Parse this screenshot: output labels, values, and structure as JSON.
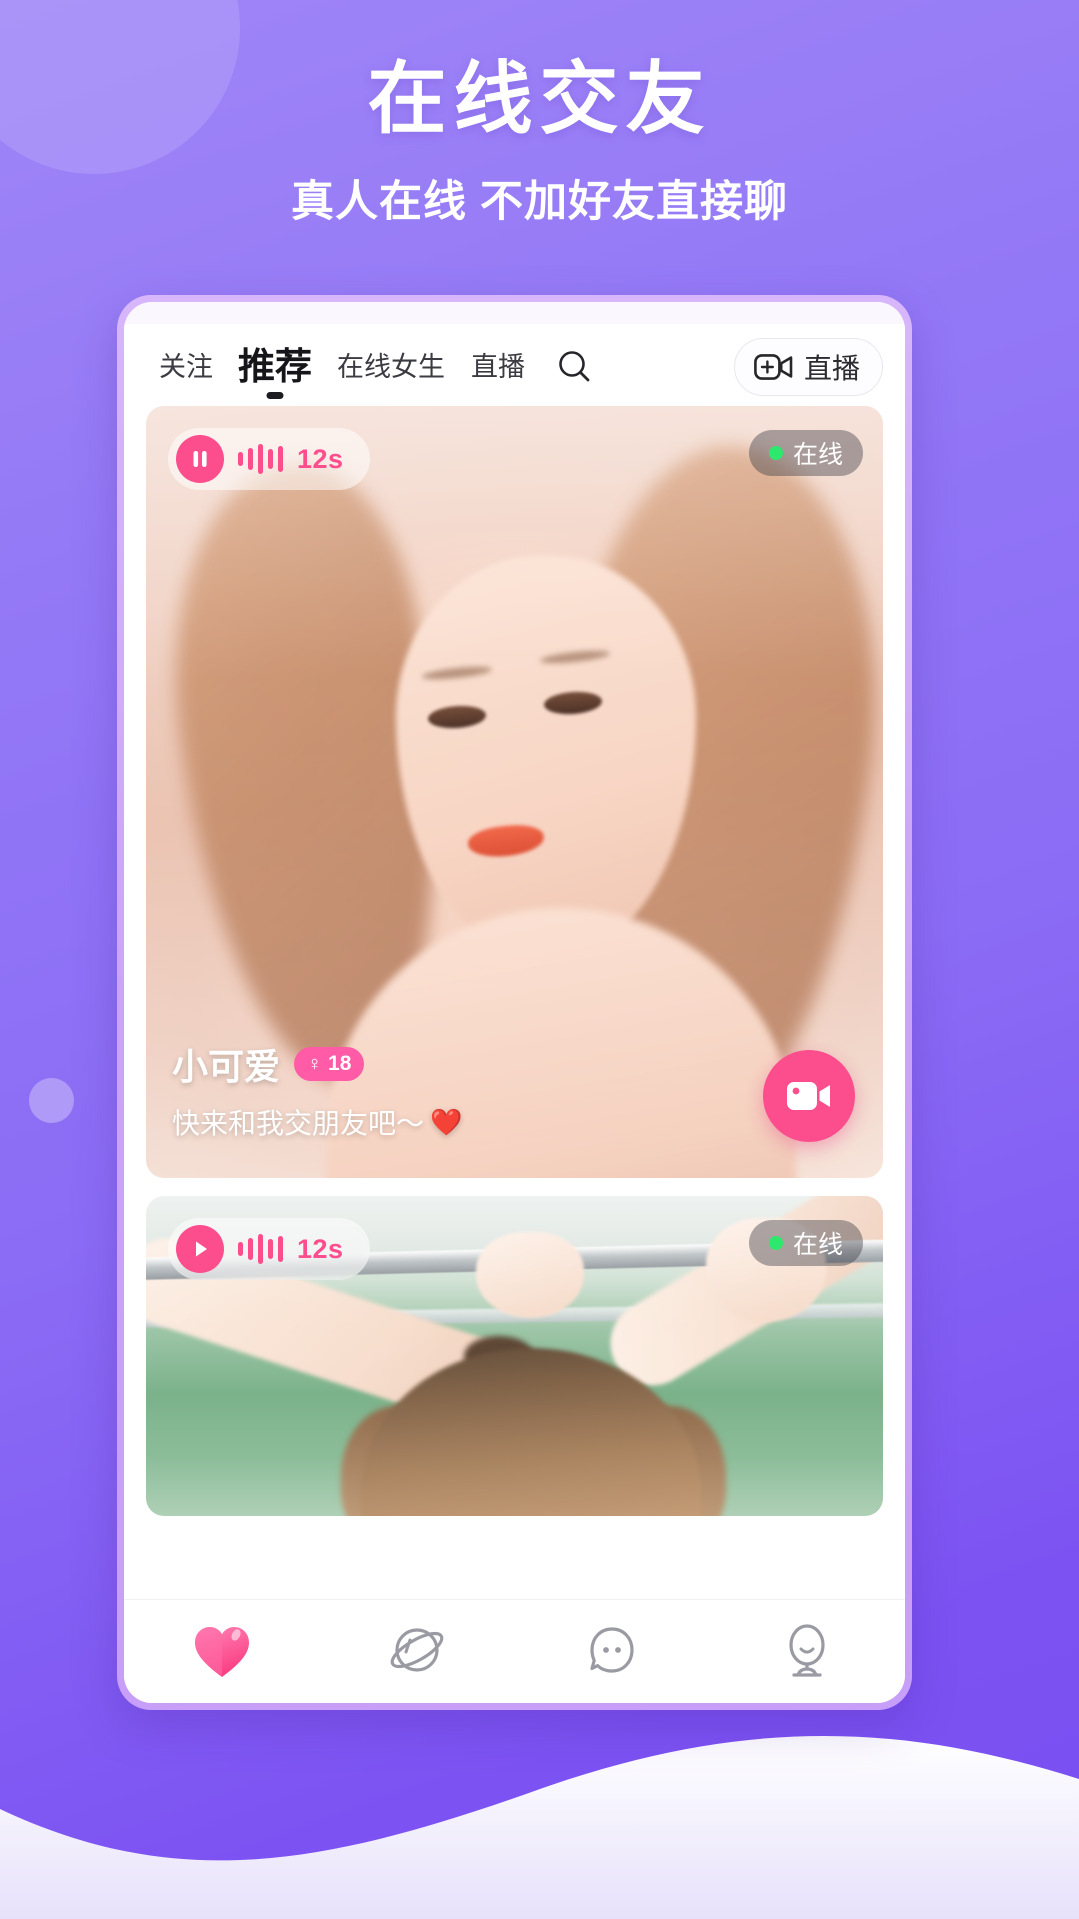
{
  "promo": {
    "headline": "在线交友",
    "subhead": "真人在线 不加好友直接聊"
  },
  "colors": {
    "bg_purple": "#8b6cf5",
    "accent_pink": "#fc4d8d",
    "badge_pink": "#ff5ba6",
    "online_green": "#2ee86e",
    "phone_frame": "#caa4f9"
  },
  "phone": {
    "statusbar": {
      "left": "",
      "right": ""
    },
    "tabs": [
      {
        "label": "关注",
        "active": false
      },
      {
        "label": "推荐",
        "active": true
      },
      {
        "label": "在线女生",
        "active": false
      },
      {
        "label": "直播",
        "active": false
      }
    ],
    "search_icon": "search-icon",
    "live_button": {
      "label": "直播",
      "icon": "video-add-icon"
    },
    "feed": [
      {
        "voice": {
          "state": "pause",
          "icon": "pause-icon",
          "duration": "12s",
          "waveform_bars": 5
        },
        "status": {
          "label": "在线",
          "dot_color": "#2ee86e"
        },
        "name": "小可爱",
        "gender_symbol": "♀",
        "age": "18",
        "bio": "快来和我交朋友吧～",
        "bio_emoji": "❤️",
        "call_button_icon": "video-call-icon"
      },
      {
        "voice": {
          "state": "play",
          "icon": "play-icon",
          "duration": "12s",
          "waveform_bars": 5
        },
        "status": {
          "label": "在线",
          "dot_color": "#2ee86e"
        }
      }
    ],
    "bottom_nav": [
      {
        "name": "heart",
        "icon": "heart-icon",
        "active": true
      },
      {
        "name": "discover",
        "icon": "planet-icon",
        "active": false
      },
      {
        "name": "messages",
        "icon": "chat-face-icon",
        "active": false
      },
      {
        "name": "profile",
        "icon": "person-icon",
        "active": false
      }
    ]
  }
}
